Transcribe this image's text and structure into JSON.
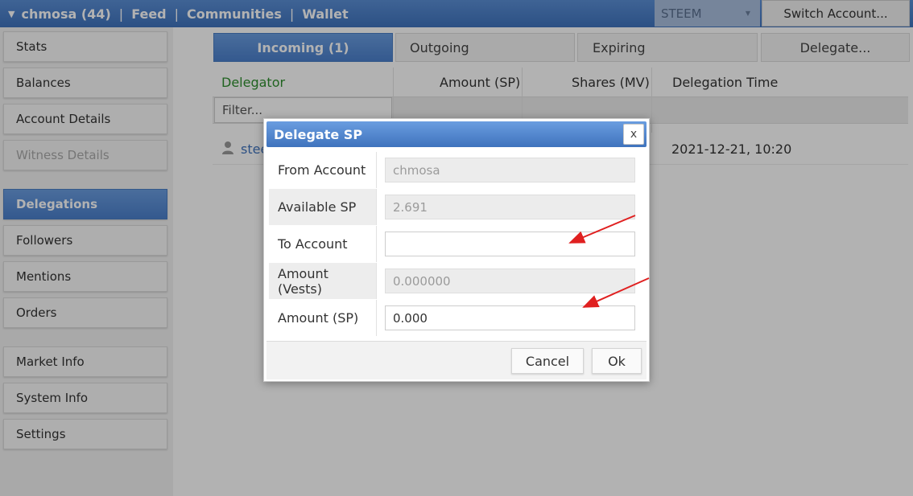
{
  "header": {
    "account": "chmosa (44)",
    "nav": [
      "Feed",
      "Communities",
      "Wallet"
    ],
    "chain_select": "STEEM",
    "switch_account": "Switch Account..."
  },
  "sidebar": {
    "items": [
      {
        "label": "Stats"
      },
      {
        "label": "Balances"
      },
      {
        "label": "Account Details"
      },
      {
        "label": "Witness Details",
        "disabled": true
      },
      {
        "label": "Delegations",
        "active": true
      },
      {
        "label": "Followers"
      },
      {
        "label": "Mentions"
      },
      {
        "label": "Orders"
      },
      {
        "label": "Market Info"
      },
      {
        "label": "System Info"
      },
      {
        "label": "Settings"
      }
    ]
  },
  "tabs": [
    {
      "label": "Incoming (1)",
      "active": true
    },
    {
      "label": "Outgoing"
    },
    {
      "label": "Expiring"
    },
    {
      "label": "Delegate..."
    }
  ],
  "table": {
    "columns": [
      "Delegator",
      "Amount (SP)",
      "Shares (MV)",
      "Delegation Time"
    ],
    "filter_placeholder": "Filter...",
    "rows": [
      {
        "delegator": "stee",
        "time": "2021-12-21, 10:20"
      }
    ]
  },
  "dialog": {
    "title": "Delegate SP",
    "close": "x",
    "fields": [
      {
        "label": "From Account",
        "value": "chmosa",
        "disabled": true
      },
      {
        "label": "Available SP",
        "value": "2.691",
        "disabled": true
      },
      {
        "label": "To Account",
        "value": "",
        "disabled": false
      },
      {
        "label": "Amount (Vests)",
        "value": "0.000000",
        "disabled": true
      },
      {
        "label": "Amount (SP)",
        "value": "0.000",
        "disabled": false
      }
    ],
    "cancel": "Cancel",
    "ok": "Ok"
  },
  "colors": {
    "accent": "#4b80cc",
    "delegator_header": "#2f8f2f",
    "annotation_arrow": "#e02020"
  }
}
